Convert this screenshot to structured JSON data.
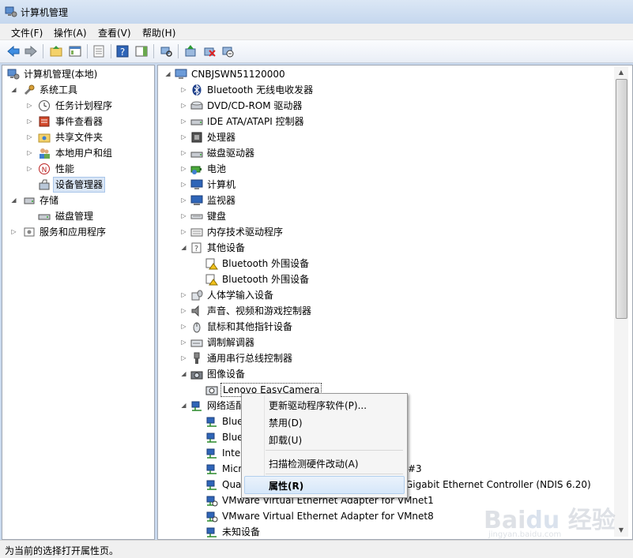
{
  "window": {
    "title": "计算机管理"
  },
  "menu": {
    "file": "文件(F)",
    "action": "操作(A)",
    "view": "查看(V)",
    "help": "帮助(H)"
  },
  "left_tree": {
    "root": "计算机管理(本地)",
    "system_tools": "系统工具",
    "task_scheduler": "任务计划程序",
    "event_viewer": "事件查看器",
    "shared_folders": "共享文件夹",
    "local_users": "本地用户和组",
    "performance": "性能",
    "device_manager": "设备管理器",
    "storage": "存储",
    "disk_management": "磁盘管理",
    "services_apps": "服务和应用程序"
  },
  "device_tree": {
    "root": "CNBJSWN51120000",
    "bluetooth": "Bluetooth 无线电收发器",
    "dvd": "DVD/CD-ROM 驱动器",
    "ide": "IDE ATA/ATAPI 控制器",
    "processor": "处理器",
    "disk_drives": "磁盘驱动器",
    "battery": "电池",
    "computer": "计算机",
    "monitor": "监视器",
    "keyboard": "键盘",
    "memory": "内存技术驱动程序",
    "other_devices": "其他设备",
    "bt_peripheral_1": "Bluetooth 外围设备",
    "bt_peripheral_2": "Bluetooth 外围设备",
    "hid": "人体学输入设备",
    "sound": "声音、视频和游戏控制器",
    "mouse": "鼠标和其他指针设备",
    "modem": "调制解调器",
    "usb": "通用串行总线控制器",
    "imaging": "图像设备",
    "lenovo_camera": "Lenovo EasyCamera",
    "network": "网络适配",
    "net_1": "Blue",
    "net_2": "Blue",
    "net_3": "Intel",
    "net_4": "Micr",
    "net_4_tail": "#3",
    "net_5": "Qual",
    "net_5_tail": "Gigabit Ethernet Controller (NDIS 6.20)",
    "vmnet1": "VMware Virtual Ethernet Adapter for VMnet1",
    "vmnet8": "VMware Virtual Ethernet Adapter for VMnet8",
    "unknown": "未知设备"
  },
  "context_menu": {
    "update_driver": "更新驱动程序软件(P)...",
    "disable": "禁用(D)",
    "uninstall": "卸载(U)",
    "scan": "扫描检测硬件改动(A)",
    "properties": "属性(R)"
  },
  "status": "为当前的选择打开属性页。",
  "watermark": {
    "brand": "Bai du 经验",
    "url": "jingyan.baidu.com"
  },
  "colors": {
    "selection": "#d9e6f6",
    "menu_highlight": "#d6e7fa",
    "warning": "#f2c21b"
  }
}
